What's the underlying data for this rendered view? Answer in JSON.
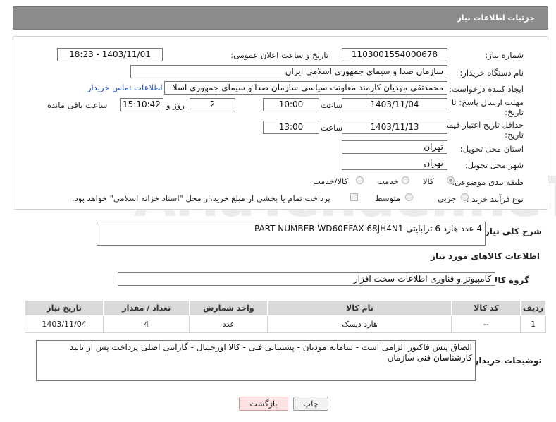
{
  "header": {
    "title": "جزئیات اطلاعات نیاز"
  },
  "form": {
    "need_number": {
      "label": "شماره نیاز:",
      "value": "1103001554000678"
    },
    "announce": {
      "label": "تاریخ و ساعت اعلان عمومی:",
      "value": "1403/11/01 - 18:23"
    },
    "buyer_org": {
      "label": "نام دستگاه خریدار:",
      "value": "سازمان صدا و سیمای جمهوری اسلامی ایران"
    },
    "requester": {
      "label": "ایجاد کننده درخواست:",
      "value": "محمدتقی مهدیان کارمند معاونت سیاسی سازمان صدا و سیمای جمهوری اسلا",
      "link": "اطلاعات تماس خریدار"
    },
    "deadline": {
      "label_line1": "مهلت ارسال پاسخ: تا",
      "label_line2": "تاریخ:",
      "date": "1403/11/04",
      "time_label": "ساعت",
      "time": "10:00",
      "days": "2",
      "days_label": "روز و",
      "remaining": "15:10:42",
      "remaining_label": "ساعت باقی مانده"
    },
    "validity": {
      "label_line1": "حداقل تاریخ اعتبار قیمت: تا",
      "label_line2": "تاریخ:",
      "date": "1403/11/13",
      "time_label": "ساعت",
      "time": "13:00"
    },
    "province": {
      "label": "استان محل تحویل:",
      "value": "تهران"
    },
    "city": {
      "label": "شهر محل تحویل:",
      "value": "تهران"
    },
    "category": {
      "label": "طبقه بندی موضوعی:",
      "options": [
        "کالا",
        "خدمت",
        "کالا/خدمت"
      ],
      "selected": "کالا"
    },
    "process": {
      "label": "نوع فرآیند خرید :",
      "options": [
        "جزیی",
        "متوسط"
      ],
      "note": "پرداخت تمام یا بخشی از مبلغ خرید،از محل \"اسناد خزانه اسلامی\" خواهد بود."
    }
  },
  "general_desc": {
    "label": "شرح کلی نیاز:",
    "value": "4 عدد هارد  6 ترابایتی PART NUMBER WD60EFAX 68JH4N1"
  },
  "goods_info": {
    "title": "اطلاعات کالاهای مورد نیاز"
  },
  "goods_group": {
    "label": "گروه کالا:",
    "value": "کامپیوتر و فناوری اطلاعات-سخت افزار"
  },
  "table": {
    "headers": [
      "ردیف",
      "کد کالا",
      "نام کالا",
      "واحد شمارش",
      "تعداد / مقدار",
      "تاریخ نیاز"
    ],
    "rows": [
      {
        "row": "1",
        "code": "--",
        "name": "هارد دیسک",
        "unit": "عدد",
        "qty": "4",
        "date": "1403/11/04"
      }
    ]
  },
  "buyer_notes": {
    "label": "توضیحات خریدار:",
    "value": "الصاق پیش فاکتور الزامی است - سامانه مودیان -  پشتیبانی فنی - کالا اورجینال - گارانتی اصلی پرداخت پس از تایید کارشناسان  فنی سازمان"
  },
  "buttons": {
    "print": "چاپ",
    "back": "بازگشت"
  },
  "watermark": "AriaTender.neT"
}
